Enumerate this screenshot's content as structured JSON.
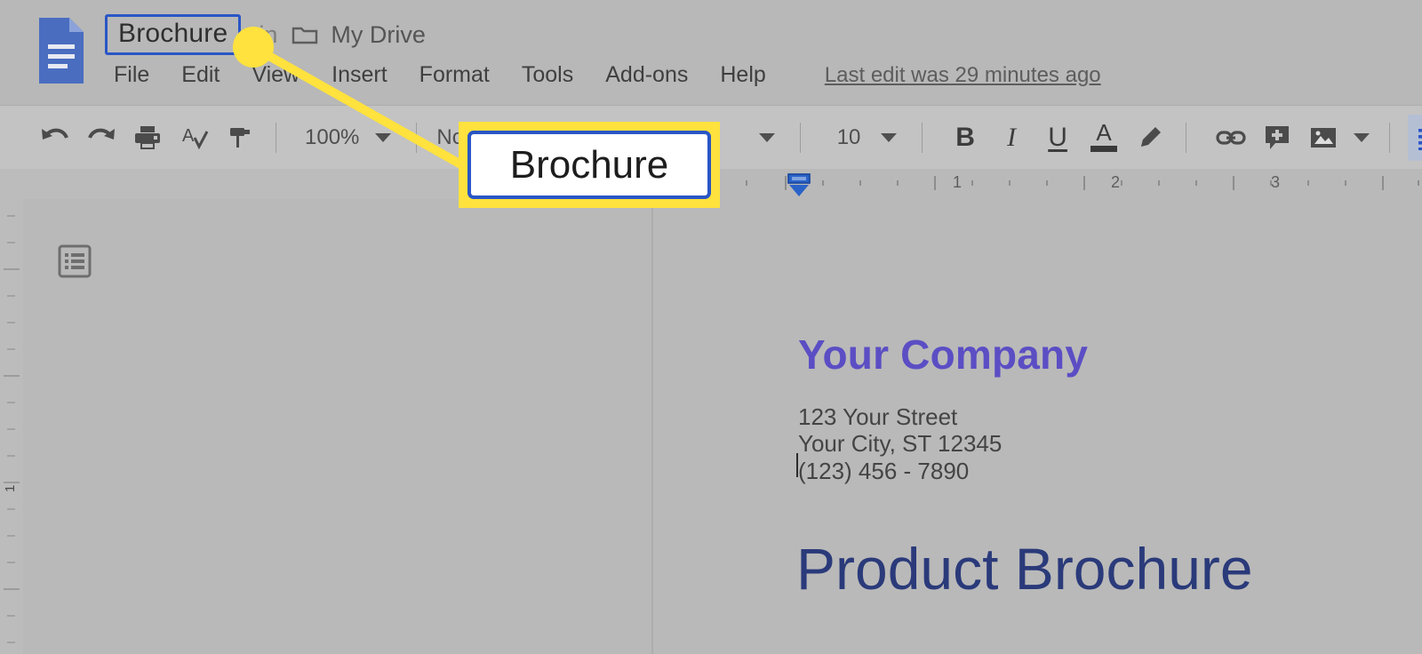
{
  "app": {
    "name": "Google Docs",
    "doc_icon": "google-docs-icon"
  },
  "header": {
    "title": "Brochure",
    "in_word": "in",
    "folder_icon": "folder-icon",
    "location": "My Drive"
  },
  "menubar": {
    "items": [
      {
        "label": "File"
      },
      {
        "label": "Edit"
      },
      {
        "label": "View"
      },
      {
        "label": "Insert"
      },
      {
        "label": "Format"
      },
      {
        "label": "Tools"
      },
      {
        "label": "Add-ons"
      },
      {
        "label": "Help"
      }
    ],
    "last_edit": "Last edit was 29 minutes ago"
  },
  "toolbar": {
    "undo_icon": "undo-icon",
    "redo_icon": "redo-icon",
    "print_icon": "print-icon",
    "spellcheck_icon": "spellcheck-icon",
    "paint_format_icon": "paint-format-icon",
    "zoom_value": "100%",
    "style_value": "Nor",
    "font_size_value": "10",
    "bold_label": "B",
    "italic_label": "I",
    "underline_label": "U",
    "text_color_label": "A",
    "highlight_icon": "highlight-pen-icon",
    "link_icon": "insert-link-icon",
    "comment_icon": "add-comment-icon",
    "image_icon": "insert-image-icon",
    "align_left_icon": "align-left-icon"
  },
  "ruler": {
    "numbers": [
      "1",
      "2",
      "3"
    ],
    "indent_marker": "left-indent-marker"
  },
  "vertical_ruler": {
    "numbers": [
      "1"
    ]
  },
  "document": {
    "outline_icon": "document-outline-icon",
    "company": "Your Company",
    "address_line1": "123 Your Street",
    "address_line2": "Your City, ST 12345",
    "address_line3": "(123) 456 - 7890",
    "heading": "Product Brochure"
  },
  "annotation": {
    "callout_text": "Brochure",
    "highlight_color": "#ffe23d",
    "box_border_color": "#2a56c6"
  },
  "colors": {
    "page_background": "#b9b9b9",
    "toolbar_background": "#c3c3c3",
    "company_text": "#5b4ec4",
    "heading_text": "#2a3a7a",
    "accent_blue": "#2a56c6",
    "annotation_yellow": "#ffe23d"
  }
}
